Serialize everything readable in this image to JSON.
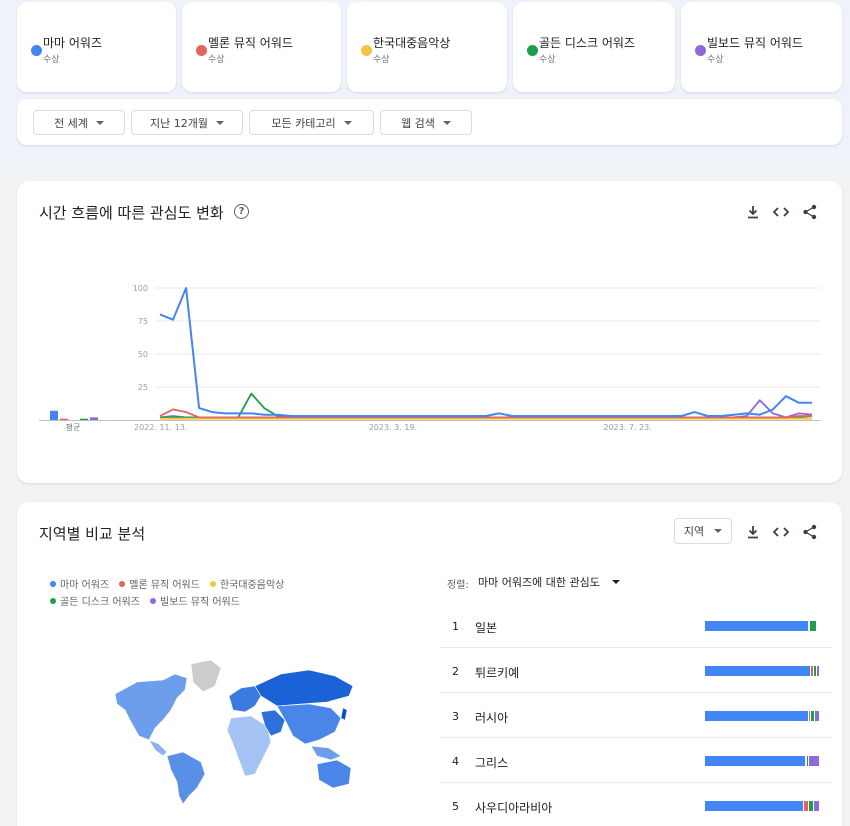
{
  "colors": {
    "blue": "#4285f4",
    "red": "#e2655c",
    "yellow": "#f4c542",
    "green": "#1e9e4a",
    "purple": "#8e6ad8"
  },
  "terms": [
    {
      "name": "마마 어워즈",
      "sub": "수상",
      "color": "#4285f4"
    },
    {
      "name": "멜론 뮤직 어워드",
      "sub": "수상",
      "color": "#e2655c"
    },
    {
      "name": "한국대중음악상",
      "sub": "수상",
      "color": "#f4c542"
    },
    {
      "name": "골든 디스크 어워즈",
      "sub": "수상",
      "color": "#1e9e4a"
    },
    {
      "name": "빌보드 뮤직 어워드",
      "sub": "수상",
      "color": "#8e6ad8"
    }
  ],
  "filters": [
    "전 세계",
    "지난 12개월",
    "모든 카테고리",
    "웹 검색"
  ],
  "interest_over_time": {
    "title": "시간 흐름에 따른 관심도 변화",
    "help": "?",
    "average_label": "평균"
  },
  "chart_data": {
    "type": "line",
    "title": "",
    "ylim": [
      0,
      100
    ],
    "yticks": [
      100,
      75,
      50,
      25
    ],
    "xtick_labels": [
      "2022. 11. 13.",
      "2023. 3. 19.",
      "2023. 7. 23."
    ],
    "xtick_index": [
      0,
      18,
      36
    ],
    "series": [
      {
        "name": "마마 어워즈",
        "color": "#4285f4",
        "values": [
          80,
          76,
          100,
          9,
          6,
          5,
          5,
          5,
          4,
          4,
          3,
          3,
          3,
          3,
          3,
          3,
          3,
          3,
          3,
          3,
          3,
          3,
          3,
          3,
          3,
          3,
          5,
          3,
          3,
          3,
          3,
          3,
          3,
          3,
          3,
          3,
          3,
          3,
          3,
          3,
          3,
          6,
          3,
          3,
          4,
          5,
          4,
          8,
          18,
          13,
          13
        ],
        "average": 7
      },
      {
        "name": "멜론 뮤직 어워드",
        "color": "#e2655c",
        "values": [
          3,
          8,
          6,
          2,
          2,
          2,
          2,
          2,
          2,
          2,
          2,
          2,
          2,
          2,
          2,
          2,
          2,
          2,
          2,
          2,
          2,
          2,
          2,
          2,
          2,
          2,
          2,
          2,
          2,
          2,
          2,
          2,
          2,
          2,
          2,
          2,
          2,
          2,
          2,
          2,
          2,
          2,
          2,
          2,
          2,
          2,
          2,
          2,
          2,
          3,
          3
        ],
        "average": 1
      },
      {
        "name": "한국대중음악상",
        "color": "#f4c542",
        "values": [
          1,
          1,
          1,
          1,
          1,
          1,
          1,
          1,
          1,
          1,
          1,
          1,
          1,
          1,
          1,
          1,
          1,
          1,
          1,
          1,
          1,
          1,
          1,
          1,
          1,
          1,
          1,
          1,
          1,
          1,
          1,
          1,
          1,
          1,
          1,
          1,
          1,
          1,
          1,
          1,
          1,
          1,
          1,
          1,
          1,
          1,
          1,
          1,
          1,
          1,
          1
        ],
        "average": 0
      },
      {
        "name": "골든 디스크 어워즈",
        "color": "#1e9e4a",
        "values": [
          2,
          2,
          2,
          2,
          2,
          2,
          2,
          20,
          9,
          3,
          2,
          2,
          2,
          2,
          2,
          2,
          2,
          2,
          2,
          2,
          2,
          2,
          2,
          2,
          2,
          2,
          2,
          2,
          2,
          2,
          2,
          2,
          2,
          2,
          2,
          2,
          2,
          2,
          2,
          2,
          2,
          2,
          2,
          2,
          2,
          2,
          2,
          2,
          2,
          2,
          3
        ],
        "average": 1
      },
      {
        "name": "빌보드 뮤직 어워드",
        "color": "#8e6ad8",
        "values": [
          2,
          3,
          2,
          2,
          2,
          2,
          2,
          2,
          2,
          2,
          2,
          2,
          2,
          2,
          2,
          2,
          2,
          3,
          2,
          2,
          2,
          2,
          2,
          2,
          2,
          2,
          2,
          2,
          2,
          2,
          2,
          2,
          2,
          2,
          2,
          2,
          2,
          2,
          2,
          2,
          2,
          2,
          2,
          2,
          2,
          3,
          15,
          5,
          2,
          5,
          4
        ],
        "average": 2
      }
    ]
  },
  "region": {
    "title": "지역별 비교 분석",
    "select_label": "지역",
    "sort_label": "정렬:",
    "sort_value": "마마 어워즈에 대한 관심도",
    "legend": [
      "마마 어워즈",
      "멜론 뮤직 어워드",
      "한국대중음악상",
      "골든 디스크 어워즈",
      "빌보드 뮤직 어워드"
    ],
    "rows": [
      {
        "rank": "1",
        "name": "일본",
        "share": [
          90,
          1,
          0,
          6,
          0
        ]
      },
      {
        "rank": "2",
        "name": "튀르키예",
        "share": [
          92,
          3,
          0,
          2,
          3
        ]
      },
      {
        "rank": "3",
        "name": "러시아",
        "share": [
          90,
          2,
          0,
          4,
          4
        ]
      },
      {
        "rank": "4",
        "name": "그리스",
        "share": [
          88,
          1,
          0,
          1,
          10
        ]
      },
      {
        "rank": "5",
        "name": "사우디아라비아",
        "share": [
          86,
          4,
          0,
          5,
          5
        ]
      }
    ]
  }
}
